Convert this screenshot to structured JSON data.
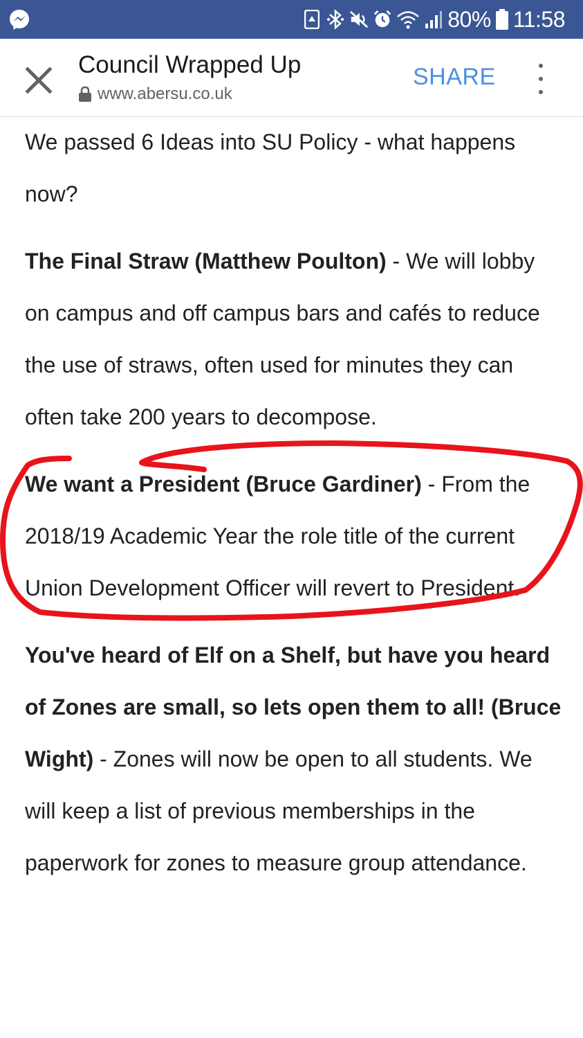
{
  "status_bar": {
    "battery": "80%",
    "time": "11:58",
    "background": "#3b5694",
    "icons": [
      "messenger-icon",
      "recycle-notification-icon",
      "bluetooth-icon",
      "mute-icon",
      "alarm-icon",
      "wifi-icon",
      "signal-icon",
      "battery-icon"
    ]
  },
  "app_bar": {
    "title": "Council Wrapped Up",
    "url": "www.abersu.co.uk",
    "share_label": "SHARE",
    "share_color": "#4a90e2"
  },
  "article": {
    "intro": "We passed 6 Ideas into SU Policy - what happens now?",
    "ideas": [
      {
        "title": "The Final Straw (Matthew Poulton)",
        "body": " - We will lobby on campus and off campus bars and cafés to reduce the use of straws, often used for minutes they can often take 200 years to decompose."
      },
      {
        "title": "We want a President (Bruce Gardiner)",
        "body": " - From the 2018/19 Academic Year the role title of the current Union Development Officer will revert to President."
      },
      {
        "title": "You've heard of Elf on a Shelf, but have you heard of Zones are small, so lets open them to all! (Bruce Wight)",
        "body": " - Zones will now be open to all students. We will keep a list of previous memberships in the paperwork for zones to measure group attendance."
      }
    ]
  },
  "annotation": {
    "color": "#e8141b"
  }
}
